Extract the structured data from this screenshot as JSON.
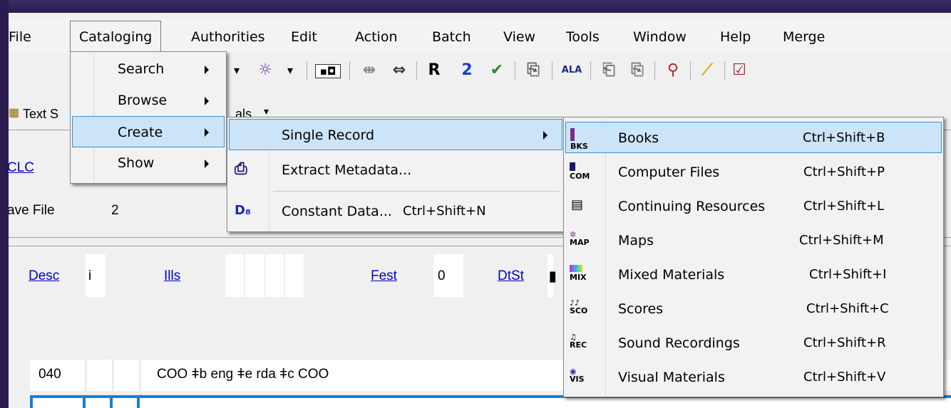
{
  "menubar": {
    "items": [
      "File",
      "Cataloging",
      "Authorities",
      "Edit",
      "Action",
      "Batch",
      "View",
      "Tools",
      "Window",
      "Help",
      "Merge"
    ]
  },
  "toolbar": {
    "r_label": "R",
    "two_label": "2",
    "ala_label": "ALA"
  },
  "tabs": {
    "text_tab": "Text S",
    "partial_tab": "als"
  },
  "content": {
    "oclc_link": "CLC",
    "save_file_label": "ave File",
    "save_file_value": "2",
    "desc_link": "Desc",
    "desc_value": "i",
    "ills_link": "Ills",
    "fest_link": "Fest",
    "fest_value": "0",
    "dtst_link": "DtSt",
    "field_tag": "040",
    "field_value": "COO ǂb eng ǂe rda ǂc COO"
  },
  "cataloging_menu": {
    "items": [
      "Search",
      "Browse",
      "Create",
      "Show"
    ]
  },
  "create_menu": {
    "single_record": "Single Record",
    "extract_metadata": "Extract Metadata...",
    "constant_data": "Constant Data...",
    "constant_data_shortcut": "Ctrl+Shift+N"
  },
  "single_record_menu": {
    "items": [
      {
        "label": "Books",
        "shortcut": "Ctrl+Shift+B",
        "icon_text": "BKS"
      },
      {
        "label": "Computer Files",
        "shortcut": "Ctrl+Shift+P",
        "icon_text": "COM"
      },
      {
        "label": "Continuing Resources",
        "shortcut": "Ctrl+Shift+L",
        "icon_text": ""
      },
      {
        "label": "Maps",
        "shortcut": "Ctrl+Shift+M",
        "icon_text": "MAP"
      },
      {
        "label": "Mixed Materials",
        "shortcut": "Ctrl+Shift+I",
        "icon_text": "MIX"
      },
      {
        "label": "Scores",
        "shortcut": "Ctrl+Shift+C",
        "icon_text": "SCO"
      },
      {
        "label": "Sound Recordings",
        "shortcut": "Ctrl+Shift+R",
        "icon_text": "REC"
      },
      {
        "label": "Visual Materials",
        "shortcut": "Ctrl+Shift+V",
        "icon_text": "VIS"
      }
    ]
  },
  "colors": {
    "highlight_bg": "#cce4f7",
    "highlight_border": "#3c8fd5",
    "link": "#0000cc",
    "accent_blue": "#1a7fd4"
  }
}
